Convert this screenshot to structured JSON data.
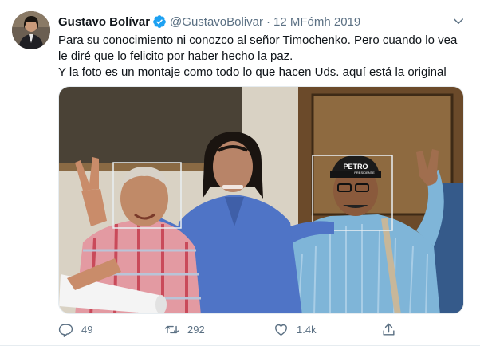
{
  "tweet": {
    "author_name": "Gustavo Bolívar",
    "handle": "@GustavoBolivar",
    "separator": "·",
    "date": "12 MFómh 2019",
    "lines": [
      "Para su conocimiento ni conozco al señor Timochenko. Pero cuando lo vea",
      "le diré que lo felicito por haber hecho la paz.",
      "Y la foto es un montaje como todo lo que hacen Uds. aquí está la original"
    ],
    "cap_text": "PETRO",
    "cap_subtext": "PRESIDENTE"
  },
  "actions": {
    "replies": "49",
    "retweets": "292",
    "likes": "1.4k"
  },
  "colors": {
    "verified": "#1da1f2",
    "muted": "#5b7083",
    "text": "#0f1419"
  },
  "icons": [
    "verified-badge-icon",
    "chevron-down-icon",
    "reply-icon",
    "retweet-icon",
    "like-icon",
    "share-icon"
  ]
}
